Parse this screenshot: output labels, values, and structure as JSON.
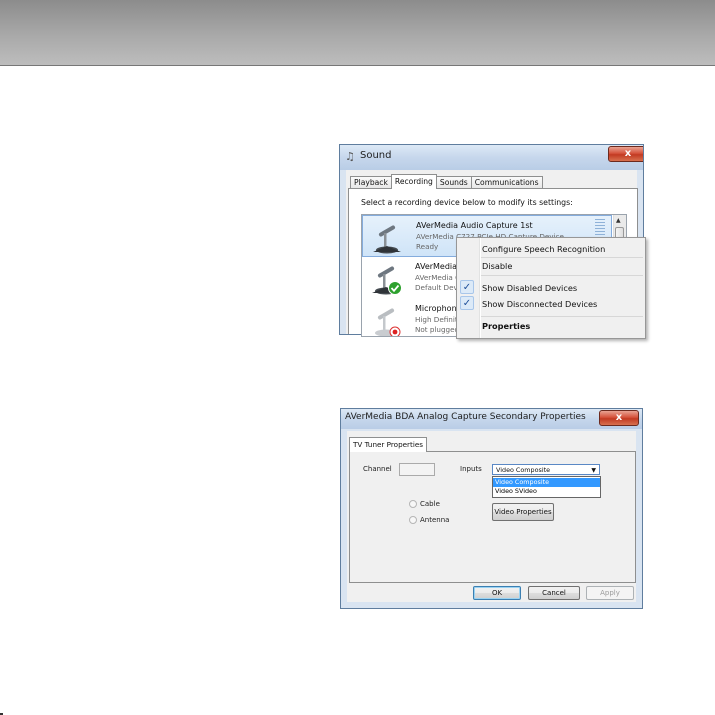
{
  "sound_dialog": {
    "title": "Sound",
    "close_glyph": "x",
    "tabs": [
      "Playback",
      "Recording",
      "Sounds",
      "Communications"
    ],
    "active_tab": "Recording",
    "instruction": "Select a recording device below to modify its settings:",
    "devices": [
      {
        "name": "AVerMedia Audio Capture 1st",
        "description": "AVerMedia C727 PCIe HD Capture Device",
        "status": "Ready",
        "icon": "microphone-icon",
        "selected": true
      },
      {
        "name": "AVerMedia A",
        "description": "AVerMedia C",
        "status": "Default Dev",
        "icon": "microphone-default-icon",
        "badge": "green-check"
      },
      {
        "name": "Microphone",
        "description": "High Definit",
        "status": "Not plugged",
        "icon": "microphone-unplugged-icon",
        "badge": "red-dot"
      }
    ]
  },
  "context_menu": {
    "items": [
      {
        "label": "Configure Speech Recognition",
        "checked": false,
        "bold": false
      },
      {
        "label": "Disable",
        "checked": false,
        "bold": false
      },
      {
        "label": "Show Disabled Devices",
        "checked": true,
        "bold": false
      },
      {
        "label": "Show Disconnected Devices",
        "checked": true,
        "bold": false
      },
      {
        "label": "Properties",
        "checked": false,
        "bold": true
      }
    ],
    "check_glyph": "✓"
  },
  "properties_dialog": {
    "title": "AVerMedia BDA Analog Capture Secondary Properties",
    "close_glyph": "x",
    "tab": "TV Tuner Properties",
    "channel_label": "Channel",
    "channel_value": "",
    "inputs_label": "Inputs",
    "inputs_selected": "Video Composite",
    "inputs_options": [
      "Video Composite",
      "Video SVideo"
    ],
    "radio_cable": "Cable",
    "radio_antenna": "Antenna",
    "video_properties_button": "Video Properties",
    "ok_button": "OK",
    "cancel_button": "Cancel",
    "apply_button": "Apply"
  },
  "colors": {
    "header_band": "#9e9e9e",
    "selection_blue": "#3399ff",
    "window_frame": "#d9e4f1",
    "close_red": "#c8442c"
  }
}
